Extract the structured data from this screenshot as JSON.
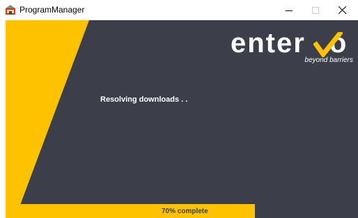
{
  "window": {
    "title": "ProgramManager",
    "minimize_icon": "minimize-icon",
    "maximize_icon": "maximize-icon",
    "close_icon": "close-icon"
  },
  "brand": {
    "logo_text": "enter",
    "logo_suffix": "o",
    "tagline": "beyond barriers",
    "accent_color": "#fec200",
    "background_color": "#3c3f4a"
  },
  "status": {
    "message": "Resolving downloads . ."
  },
  "progress": {
    "percent": 70,
    "label": "70% complete"
  }
}
